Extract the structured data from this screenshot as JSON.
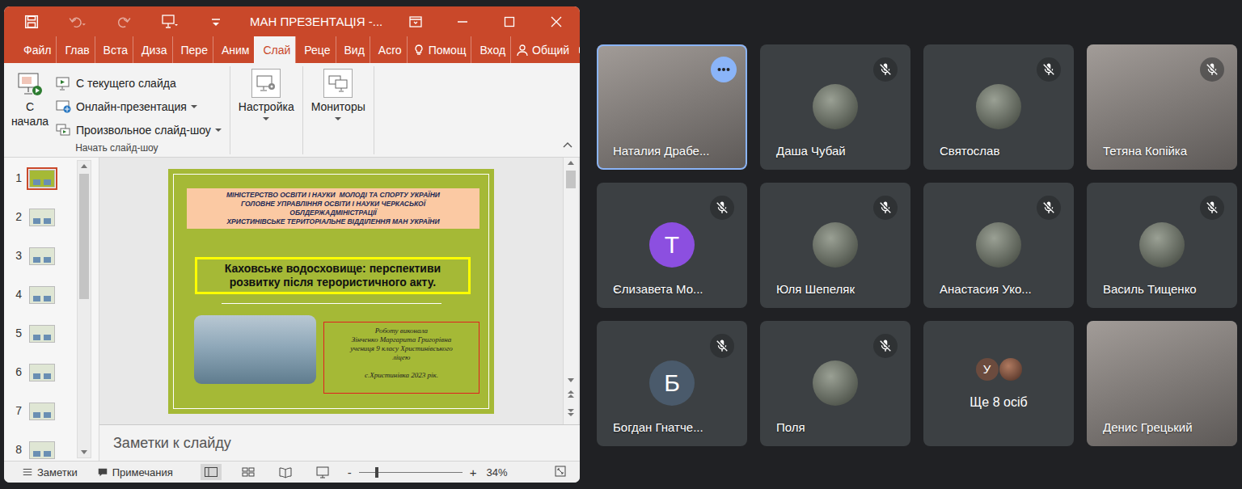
{
  "window": {
    "title": "МАН ПРЕЗЕНТАЦІЯ -..."
  },
  "quick_access": [
    {
      "kind": "save",
      "disabled": false
    },
    {
      "kind": "undo",
      "disabled": true
    },
    {
      "kind": "redo",
      "disabled": true
    },
    {
      "kind": "present",
      "disabled": false
    },
    {
      "kind": "customize",
      "disabled": false
    }
  ],
  "tabs": [
    {
      "label": "Файл",
      "kind": "text",
      "selected": false
    },
    {
      "label": "Глав",
      "kind": "text",
      "selected": false
    },
    {
      "label": "Вста",
      "kind": "text",
      "selected": false
    },
    {
      "label": "Диза",
      "kind": "text",
      "selected": false
    },
    {
      "label": "Пере",
      "kind": "text",
      "selected": false
    },
    {
      "label": "Аним",
      "kind": "text",
      "selected": false
    },
    {
      "label": "Слай",
      "kind": "text",
      "selected": true
    },
    {
      "label": "Реце",
      "kind": "text",
      "selected": false
    },
    {
      "label": "Вид",
      "kind": "text",
      "selected": false
    },
    {
      "label": "Acro",
      "kind": "text",
      "selected": false
    },
    {
      "label": "Помощ",
      "kind": "help",
      "selected": false
    },
    {
      "label": "Вход",
      "kind": "text",
      "selected": false
    },
    {
      "label": "Общий",
      "kind": "share",
      "selected": false
    }
  ],
  "ribbon": {
    "groups": [
      {
        "label": "Начать слайд-шоу",
        "buttons": [
          {
            "label": "С начала",
            "kind": "start",
            "dropdown": false
          },
          {
            "label": "С текущего слайда",
            "kind": "small",
            "dropdown": false
          },
          {
            "label": "Онлайн-презентация",
            "kind": "small",
            "dropdown": true
          },
          {
            "label": "Произвольное слайд-шоу",
            "kind": "small",
            "dropdown": true
          }
        ]
      },
      {
        "buttons": [
          {
            "label": "Настройка",
            "kind": "boxed",
            "dropdown": true
          }
        ]
      },
      {
        "buttons": [
          {
            "label": "Мониторы",
            "kind": "boxed",
            "dropdown": true
          }
        ]
      }
    ]
  },
  "thumbnails": [
    {
      "number": "1",
      "selected": true
    },
    {
      "number": "2",
      "selected": false
    },
    {
      "number": "3",
      "selected": false
    },
    {
      "number": "4",
      "selected": false
    },
    {
      "number": "5",
      "selected": false
    },
    {
      "number": "6",
      "selected": false
    },
    {
      "number": "7",
      "selected": false
    },
    {
      "number": "8",
      "selected": false
    }
  ],
  "slide": {
    "header": [
      "МІНІСТЕРСТВО ОСВІТИ І НАУКИ  МОЛОДІ ТА СПОРТУ УКРАЇНИ",
      "ГОЛОВНЕ УПРАВЛІННЯ ОСВІТИ І НАУКИ ЧЕРКАСЬКОЇ",
      "ОБЛДЕРЖАДМІНІСТРАЦІЇ",
      "ХРИСТИНІВСЬКЕ ТЕРИТОРІАЛЬНЕ ВІДДІЛЕННЯ МАН УКРАЇНИ"
    ],
    "title": [
      "Каховське водосховище: перспективи",
      "розвитку після терористичного акту."
    ],
    "author": [
      "Роботу виконала",
      "Зінченко Маргарита Григорівна",
      "учениця 9 класу Христинівського",
      "ліцею",
      "с.Христинівка 2023 рік."
    ]
  },
  "notes": {
    "placeholder": "Заметки к слайду"
  },
  "status_bar": {
    "notes": "Заметки",
    "comments": "Примечания",
    "views": [
      {
        "kind": "normal",
        "selected": true
      },
      {
        "kind": "sorter",
        "selected": false
      },
      {
        "kind": "reading",
        "selected": false
      },
      {
        "kind": "slideshow",
        "selected": false
      }
    ],
    "zoom_out": "-",
    "zoom_in": "+",
    "zoom": "34%",
    "zoom_level": 0.17
  },
  "participants": [
    {
      "name": "Наталия Драбе...",
      "kind": "video",
      "muted": false,
      "highlighted": true
    },
    {
      "name": "Даша Чубай",
      "kind": "avatar-photo",
      "muted": true,
      "highlighted": false
    },
    {
      "name": "Святослав",
      "kind": "avatar-photo",
      "muted": true,
      "highlighted": false
    },
    {
      "name": "Тетяна Копійка",
      "kind": "video",
      "muted": true,
      "highlighted": false
    },
    {
      "name": "Єлизавета Мо...",
      "kind": "avatar-letter",
      "letter": "Т",
      "color": "#8c4fe0",
      "muted": true,
      "highlighted": false
    },
    {
      "name": "Юля Шепеляк",
      "kind": "avatar-photo",
      "muted": true,
      "highlighted": false
    },
    {
      "name": "Анастасия Уко...",
      "kind": "avatar-photo",
      "muted": true,
      "highlighted": false
    },
    {
      "name": "Василь Тищенко",
      "kind": "avatar-photo",
      "muted": true,
      "highlighted": false
    },
    {
      "name": "Богдан Гнатче...",
      "kind": "avatar-letter",
      "letter": "Б",
      "color": "#4a5a6b",
      "muted": true,
      "highlighted": false
    },
    {
      "name": "Поля",
      "kind": "avatar-photo",
      "muted": true,
      "highlighted": false
    },
    {
      "name": "Ще 8 осіб",
      "kind": "more",
      "letter": "У",
      "color": "#6b4b3e",
      "muted": false,
      "highlighted": false
    },
    {
      "name": "Денис Грецький",
      "kind": "video",
      "muted": false,
      "highlighted": false
    }
  ]
}
